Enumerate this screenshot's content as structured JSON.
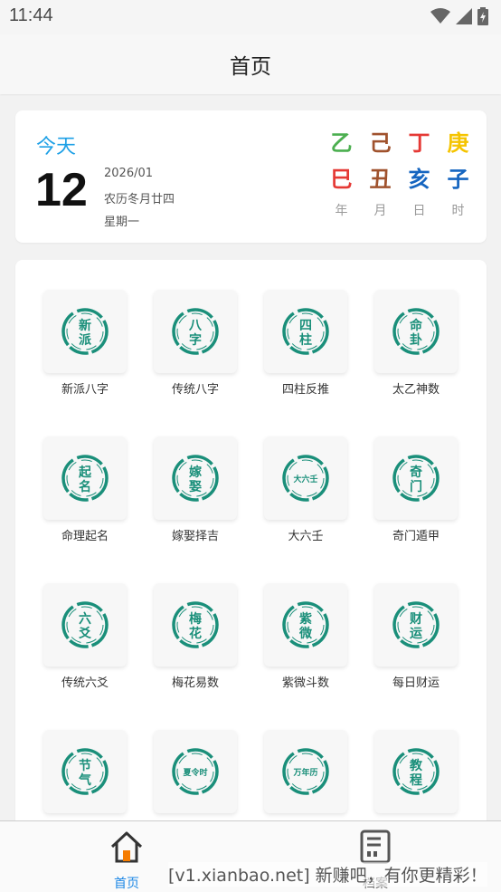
{
  "status": {
    "time": "11:44",
    "icons": [
      "wifi-icon",
      "signal-icon",
      "battery-icon"
    ]
  },
  "appbar": {
    "title": "首页"
  },
  "date": {
    "today_label": "今天",
    "day": "12",
    "year_month": "2026/01",
    "lunar": "农历冬月廿四",
    "weekday": "星期一"
  },
  "ganzhi": {
    "stems": [
      {
        "char": "乙",
        "color": "#4caf50"
      },
      {
        "char": "己",
        "color": "#a0522d"
      },
      {
        "char": "丁",
        "color": "#e53935"
      },
      {
        "char": "庚",
        "color": "#f5c400"
      }
    ],
    "branches": [
      {
        "char": "巳",
        "color": "#e53935"
      },
      {
        "char": "丑",
        "color": "#a0522d"
      },
      {
        "char": "亥",
        "color": "#1565c0"
      },
      {
        "char": "子",
        "color": "#1565c0"
      }
    ],
    "labels": [
      "年",
      "月",
      "日",
      "时"
    ]
  },
  "grid": {
    "items": [
      {
        "label": "新派八字",
        "seal": [
          "新",
          "派"
        ],
        "icon": "xinpai-seal-icon"
      },
      {
        "label": "传统八字",
        "seal": [
          "八",
          "字"
        ],
        "icon": "bazi-seal-icon"
      },
      {
        "label": "四柱反推",
        "seal": [
          "四",
          "柱"
        ],
        "icon": "sizhu-seal-icon"
      },
      {
        "label": "太乙神数",
        "seal": [
          "命",
          "卦"
        ],
        "icon": "minggua-seal-icon"
      },
      {
        "label": "命理起名",
        "seal": [
          "起",
          "名"
        ],
        "icon": "qiming-seal-icon"
      },
      {
        "label": "嫁娶择吉",
        "seal": [
          "嫁",
          "娶"
        ],
        "icon": "jiaqu-seal-icon"
      },
      {
        "label": "大六壬",
        "seal": [
          "大六壬"
        ],
        "icon": "daliuren-seal-icon"
      },
      {
        "label": "奇门遁甲",
        "seal": [
          "奇",
          "门"
        ],
        "icon": "qimen-seal-icon"
      },
      {
        "label": "传统六爻",
        "seal": [
          "六",
          "爻"
        ],
        "icon": "liuyao-seal-icon"
      },
      {
        "label": "梅花易数",
        "seal": [
          "梅",
          "花"
        ],
        "icon": "meihua-seal-icon"
      },
      {
        "label": "紫微斗数",
        "seal": [
          "紫",
          "微"
        ],
        "icon": "ziwei-seal-icon"
      },
      {
        "label": "每日财运",
        "seal": [
          "财",
          "运"
        ],
        "icon": "caiyun-seal-icon"
      },
      {
        "label": "",
        "seal": [
          "节",
          "气"
        ],
        "icon": "jieqi-seal-icon"
      },
      {
        "label": "",
        "seal": [
          "夏令时"
        ],
        "icon": "xialingshi-seal-icon"
      },
      {
        "label": "",
        "seal": [
          "万年历"
        ],
        "icon": "wannianli-seal-icon"
      },
      {
        "label": "",
        "seal": [
          "教",
          "程"
        ],
        "icon": "jiaocheng-seal-icon"
      }
    ],
    "seal_color": "#1a8f7a"
  },
  "bottom_nav": {
    "home_label": "首页",
    "archive_label": "档案"
  },
  "watermark": "[v1.xianbao.net] 新赚吧，有你更精彩！"
}
